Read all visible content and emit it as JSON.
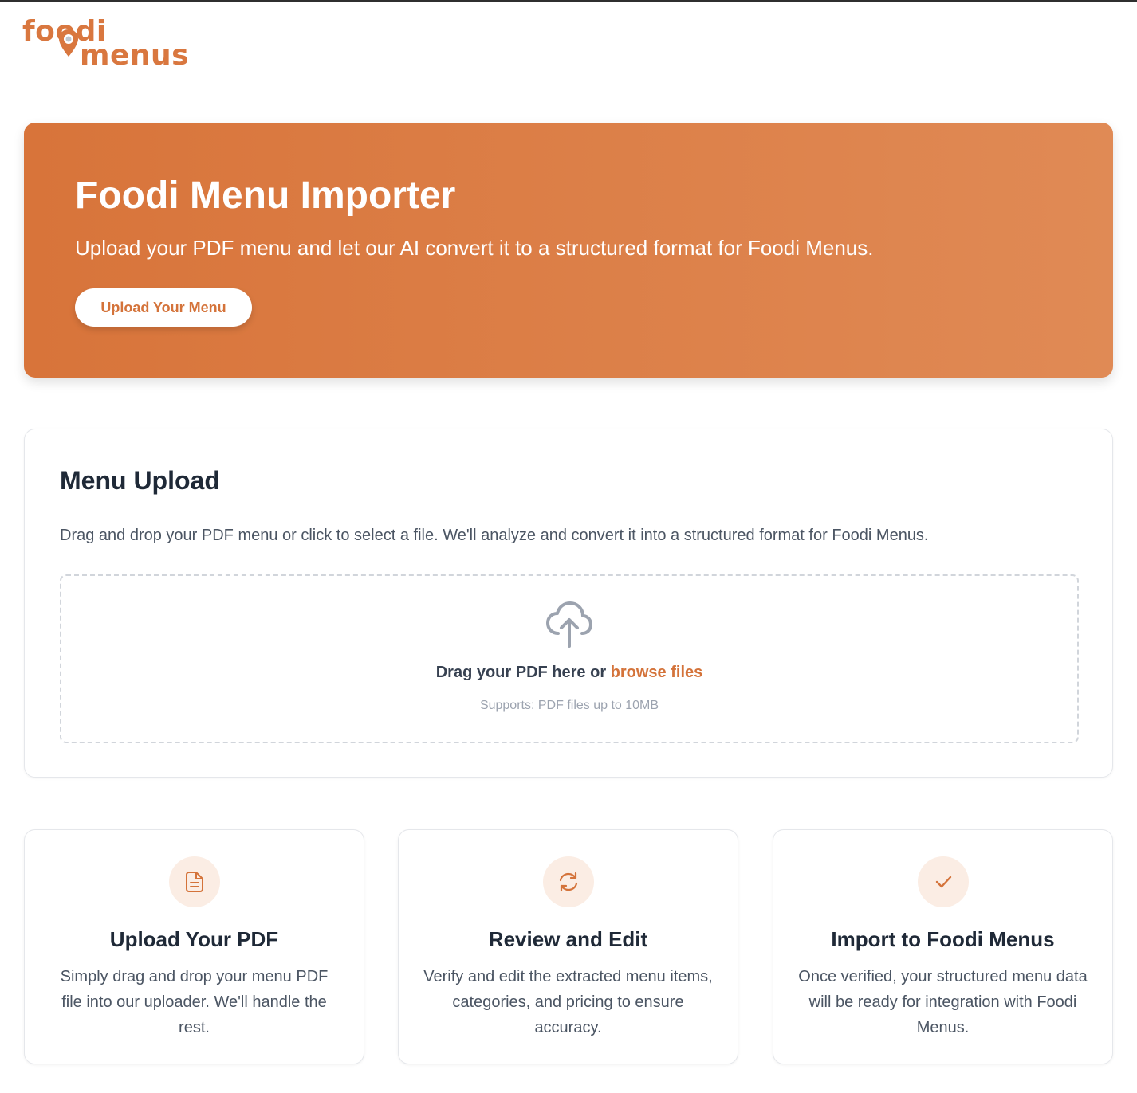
{
  "brand": {
    "logo_line1": "foodi",
    "logo_line2": "menus",
    "accent": "#d8743a"
  },
  "hero": {
    "title": "Foodi Menu Importer",
    "subtitle": "Upload your PDF menu and let our AI convert it to a structured format for Foodi Menus.",
    "button_label": "Upload Your Menu"
  },
  "upload": {
    "title": "Menu Upload",
    "description": "Drag and drop your PDF menu or click to select a file. We'll analyze and convert it into a structured format for Foodi Menus.",
    "dropzone_prefix": "Drag your PDF here or ",
    "dropzone_link": "browse files",
    "dropzone_hint": "Supports: PDF files up to 10MB",
    "icon": "cloud-upload-icon"
  },
  "features": [
    {
      "icon": "file-text-icon",
      "title": "Upload Your PDF",
      "text": "Simply drag and drop your menu PDF file into our uploader. We'll handle the rest."
    },
    {
      "icon": "refresh-icon",
      "title": "Review and Edit",
      "text": "Verify and edit the extracted menu items, categories, and pricing to ensure accuracy."
    },
    {
      "icon": "check-icon",
      "title": "Import to Foodi Menus",
      "text": "Once verified, your structured menu data will be ready for integration with Foodi Menus."
    }
  ]
}
